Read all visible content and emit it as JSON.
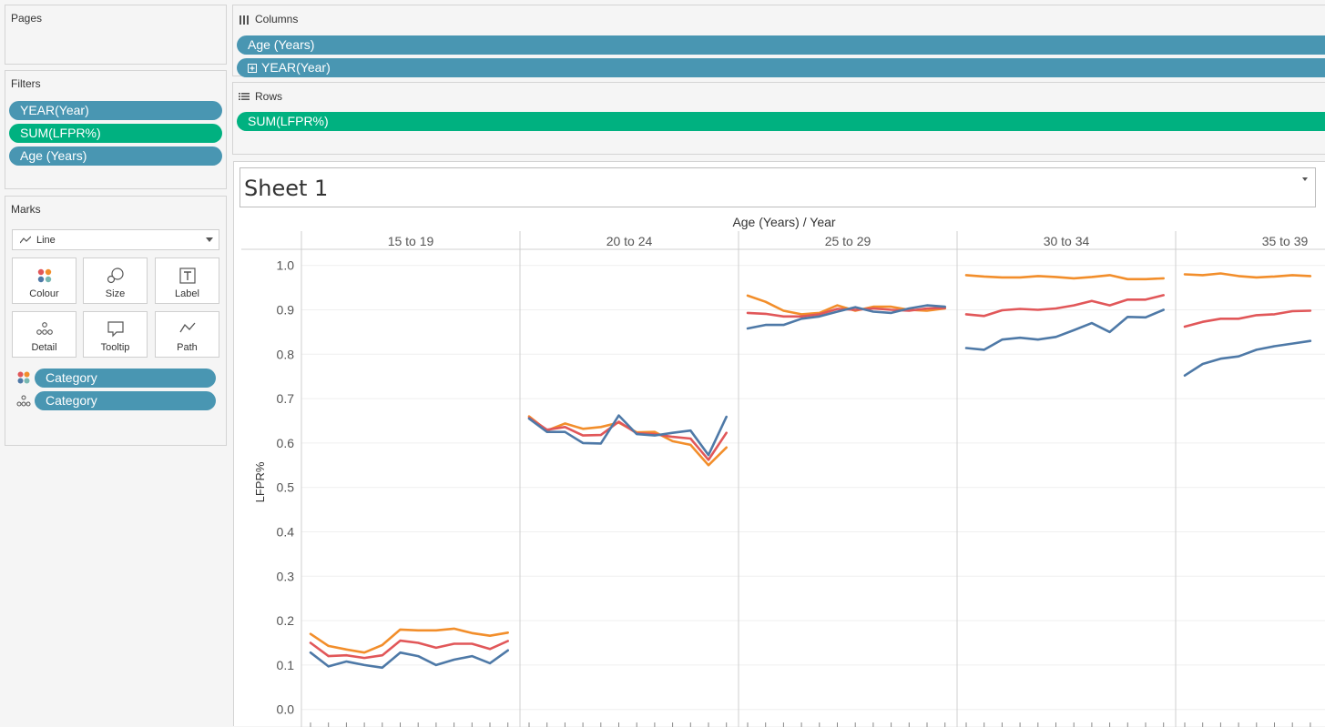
{
  "pages": {
    "title": "Pages"
  },
  "filters": {
    "title": "Filters",
    "items": [
      {
        "label": "YEAR(Year)",
        "color": "#4996b2"
      },
      {
        "label": "SUM(LFPR%)",
        "color": "#00b180"
      },
      {
        "label": "Age (Years)",
        "color": "#4996b2"
      }
    ]
  },
  "marks": {
    "title": "Marks",
    "type": "Line",
    "buttons": [
      "Colour",
      "Size",
      "Label",
      "Detail",
      "Tooltip",
      "Path"
    ],
    "fields": [
      {
        "icon": "colour-icon",
        "label": "Category"
      },
      {
        "icon": "detail-icon",
        "label": "Category"
      }
    ]
  },
  "columns": {
    "label": "Columns",
    "pills": [
      "Age (Years)",
      "YEAR(Year)"
    ]
  },
  "rows": {
    "label": "Rows",
    "pills": [
      "SUM(LFPR%)"
    ]
  },
  "sheet": {
    "title": "Sheet 1"
  },
  "colors": {
    "orange": "#f28e2b",
    "red": "#e15759",
    "blue": "#4e79a7",
    "pill_blue": "#4996b2",
    "pill_green": "#00b180"
  },
  "chart_data": {
    "type": "line",
    "header": "Age (Years)  /  Year",
    "ylabel": "LFPR%",
    "ylim": [
      -0.02,
      1.05
    ],
    "yticks": [
      "1.0",
      "0.9",
      "0.8",
      "0.7",
      "0.6",
      "0.5",
      "0.4",
      "0.3",
      "0.2",
      "0.1",
      "0.0"
    ],
    "panels": [
      {
        "label": "15 to 19",
        "series": [
          {
            "color": "#f28e2b",
            "values": [
              0.17,
              0.143,
              0.135,
              0.128,
              0.145,
              0.18,
              0.178,
              0.178,
              0.182,
              0.172,
              0.166,
              0.173
            ]
          },
          {
            "color": "#e15759",
            "values": [
              0.15,
              0.12,
              0.122,
              0.116,
              0.122,
              0.155,
              0.15,
              0.139,
              0.148,
              0.148,
              0.136,
              0.154
            ]
          },
          {
            "color": "#4e79a7",
            "values": [
              0.128,
              0.097,
              0.108,
              0.1,
              0.094,
              0.128,
              0.12,
              0.1,
              0.112,
              0.12,
              0.104,
              0.133
            ]
          }
        ]
      },
      {
        "label": "20 to 24",
        "series": [
          {
            "color": "#f28e2b",
            "values": [
              0.66,
              0.628,
              0.644,
              0.632,
              0.636,
              0.646,
              0.624,
              0.625,
              0.604,
              0.596,
              0.55,
              0.59
            ]
          },
          {
            "color": "#e15759",
            "values": [
              0.657,
              0.63,
              0.636,
              0.617,
              0.618,
              0.648,
              0.622,
              0.62,
              0.614,
              0.61,
              0.562,
              0.623
            ]
          },
          {
            "color": "#4e79a7",
            "values": [
              0.655,
              0.625,
              0.625,
              0.6,
              0.599,
              0.662,
              0.62,
              0.617,
              0.623,
              0.628,
              0.573,
              0.659
            ]
          }
        ]
      },
      {
        "label": "25 to 29",
        "series": [
          {
            "color": "#f28e2b",
            "values": [
              0.932,
              0.918,
              0.898,
              0.89,
              0.893,
              0.91,
              0.898,
              0.907,
              0.907,
              0.9,
              0.898,
              0.903
            ]
          },
          {
            "color": "#e15759",
            "values": [
              0.893,
              0.891,
              0.885,
              0.885,
              0.89,
              0.902,
              0.9,
              0.903,
              0.9,
              0.898,
              0.903,
              0.904
            ]
          },
          {
            "color": "#4e79a7",
            "values": [
              0.858,
              0.866,
              0.866,
              0.88,
              0.885,
              0.896,
              0.906,
              0.896,
              0.893,
              0.903,
              0.91,
              0.907
            ]
          }
        ]
      },
      {
        "label": "30 to 34",
        "series": [
          {
            "color": "#f28e2b",
            "values": [
              0.978,
              0.975,
              0.973,
              0.973,
              0.976,
              0.974,
              0.971,
              0.974,
              0.978,
              0.969,
              0.969,
              0.971
            ]
          },
          {
            "color": "#e15759",
            "values": [
              0.89,
              0.886,
              0.899,
              0.902,
              0.9,
              0.903,
              0.91,
              0.92,
              0.91,
              0.923,
              0.923,
              0.933
            ]
          },
          {
            "color": "#4e79a7",
            "values": [
              0.814,
              0.81,
              0.833,
              0.837,
              0.833,
              0.839,
              0.854,
              0.87,
              0.85,
              0.884,
              0.883,
              0.9
            ]
          }
        ]
      },
      {
        "label": "35 to 39",
        "series": [
          {
            "color": "#f28e2b",
            "values": [
              0.98,
              0.978,
              0.982,
              0.976,
              0.973,
              0.975,
              0.978,
              0.976
            ]
          },
          {
            "color": "#e15759",
            "values": [
              0.862,
              0.873,
              0.88,
              0.88,
              0.888,
              0.89,
              0.897,
              0.898
            ]
          },
          {
            "color": "#4e79a7",
            "values": [
              0.752,
              0.778,
              0.79,
              0.795,
              0.81,
              0.818,
              0.824,
              0.83
            ]
          }
        ]
      }
    ]
  }
}
